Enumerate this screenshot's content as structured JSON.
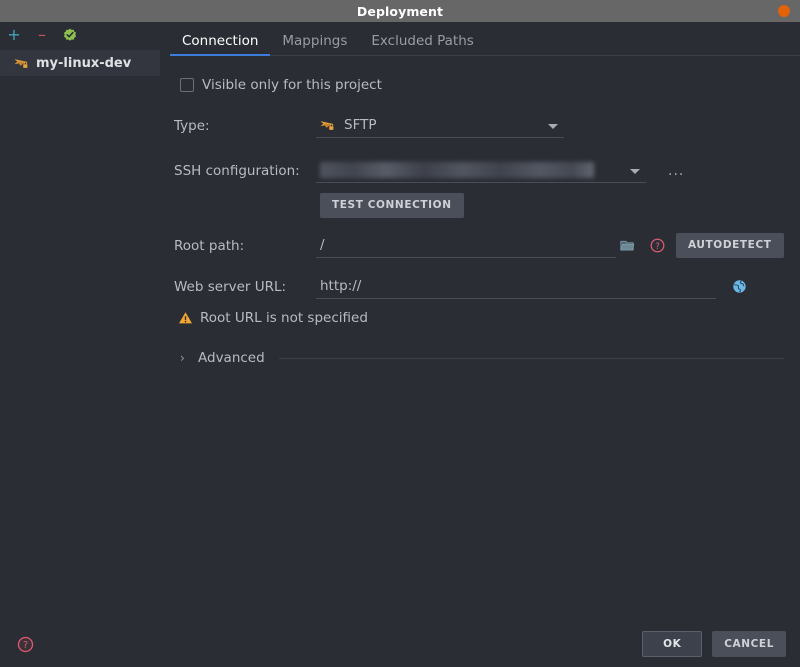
{
  "window": {
    "title": "Deployment",
    "close_icon": "close-circle-icon"
  },
  "sidebar": {
    "toolbar": [
      {
        "name": "add",
        "label": "+",
        "icon": "plus-icon"
      },
      {
        "name": "remove",
        "label": "–",
        "icon": "minus-icon"
      },
      {
        "name": "set-default",
        "label": "",
        "icon": "green-check-badge-icon"
      }
    ],
    "items": [
      {
        "label": "my-linux-dev",
        "icon": "sftp-server-icon",
        "selected": true
      }
    ]
  },
  "tabs": [
    {
      "label": "Connection",
      "active": true
    },
    {
      "label": "Mappings",
      "active": false
    },
    {
      "label": "Excluded Paths",
      "active": false
    }
  ],
  "form": {
    "visible_only_checkbox": {
      "label": "Visible only for this project",
      "checked": false
    },
    "type": {
      "label": "Type:",
      "value": "SFTP",
      "icon": "sftp-icon"
    },
    "ssh_configuration": {
      "label": "SSH configuration:",
      "value": "",
      "redacted": true,
      "more_button_label": "...",
      "dropdown_icon": "chevron-down-icon"
    },
    "test_connection_label": "TEST CONNECTION",
    "root_path": {
      "label": "Root path:",
      "value": "/",
      "browse_icon": "folder-icon",
      "help_icon": "help-circle-icon",
      "autodetect_label": "AUTODETECT"
    },
    "web_server_url": {
      "label": "Web server URL:",
      "value": "http://",
      "open_icon": "globe-icon"
    },
    "warning": {
      "icon": "warning-triangle-icon",
      "text": "Root URL is not specified"
    },
    "advanced": {
      "label": "Advanced",
      "expanded": false,
      "icon": "chevron-right-icon"
    }
  },
  "footer": {
    "help_icon": "help-circle-icon",
    "ok_label": "OK",
    "cancel_label": "CANCEL"
  },
  "colors": {
    "background": "#2b2d35",
    "titlebar": "#676767",
    "accent_tab": "#3c7ddc",
    "close_button": "#e2620a",
    "warning": "#f0a732",
    "help": "#db5c6e",
    "sftp_icon": "#e8a33d",
    "globe": "#6ab7e8",
    "selected_row": "#33363f"
  }
}
